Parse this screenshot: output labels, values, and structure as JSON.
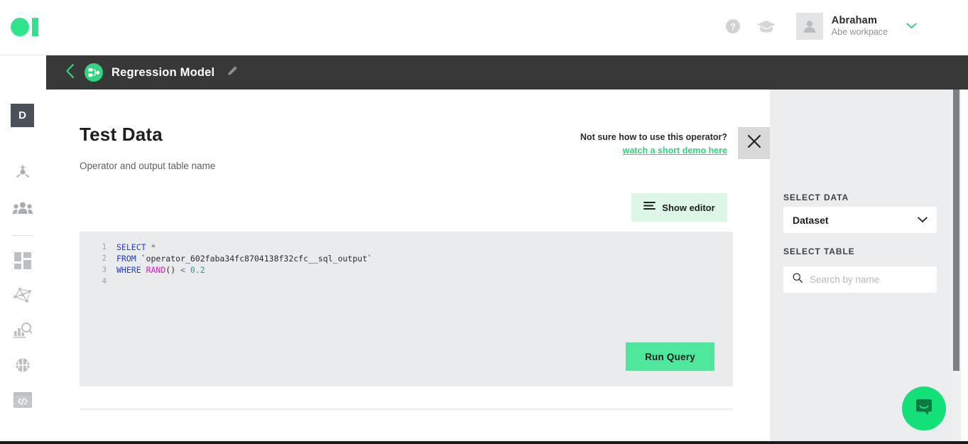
{
  "topbar": {
    "logo_name": "brand-logo",
    "help_icon": "help-circle-icon",
    "learn_icon": "graduation-cap-icon",
    "user": {
      "name": "Abraham",
      "workspace": "Abe workpace",
      "avatar_icon": "user-avatar-icon",
      "caret_icon": "chevron-down-icon"
    }
  },
  "projectbar": {
    "back_icon": "chevron-left-icon",
    "operator_icon": "workflow-node-icon",
    "title": "Regression Model",
    "edit_icon": "pencil-icon"
  },
  "rail": {
    "badge_label": "D",
    "items": [
      {
        "name": "sidebar-item-data-flow",
        "icon": "data-flow-icon"
      },
      {
        "name": "sidebar-item-team",
        "icon": "people-group-icon"
      },
      {
        "name": "sidebar-item-dashboard",
        "icon": "dashboard-grid-icon"
      },
      {
        "name": "sidebar-item-network",
        "icon": "network-graph-icon"
      },
      {
        "name": "sidebar-item-analytics",
        "icon": "chart-search-icon"
      },
      {
        "name": "sidebar-item-ml",
        "icon": "brain-icon"
      },
      {
        "name": "sidebar-item-code",
        "icon": "code-window-icon"
      }
    ]
  },
  "main": {
    "title": "Test Data",
    "subtitle": "Operator and output table name",
    "demo": {
      "question": "Not sure how to use this operator?",
      "link": "watch a short demo here"
    },
    "close_icon": "close-x-icon",
    "show_editor": {
      "label": "Show editor",
      "icon": "editor-lines-icon"
    },
    "editor": {
      "line_numbers": [
        "1",
        "2",
        "3",
        "4"
      ],
      "lines": [
        {
          "n": "1",
          "tokens": [
            {
              "t": "SELECT",
              "c": "kw"
            },
            {
              "t": " ",
              "c": "punct"
            },
            {
              "t": "*",
              "c": "op"
            }
          ]
        },
        {
          "n": "2",
          "tokens": [
            {
              "t": "FROM",
              "c": "kw"
            },
            {
              "t": " `operator_602faba34fc8704138f32cfc__sql_output`",
              "c": "str"
            }
          ]
        },
        {
          "n": "3",
          "tokens": [
            {
              "t": "WHERE",
              "c": "kw"
            },
            {
              "t": " ",
              "c": "punct"
            },
            {
              "t": "RAND",
              "c": "fn"
            },
            {
              "t": "()",
              "c": "punct"
            },
            {
              "t": " < ",
              "c": "op"
            },
            {
              "t": "0.2",
              "c": "num"
            }
          ]
        },
        {
          "n": "4",
          "tokens": []
        }
      ],
      "plain_text": "SELECT *\nFROM `operator_602faba34fc8704138f32cfc__sql_output`\nWHERE RAND() < 0.2\n"
    },
    "run_query_label": "Run Query"
  },
  "rightpanel": {
    "select_data_label": "SELECT DATA",
    "select_data_value": "Dataset",
    "select_data_caret": "chevron-down-icon",
    "select_table_label": "SELECT TABLE",
    "search_icon": "search-icon",
    "search_placeholder": "Search by name",
    "search_value": ""
  },
  "chat": {
    "icon": "intercom-chat-icon"
  },
  "colors": {
    "brand_green": "#2fe48d",
    "button_green": "#4fe79b",
    "link_green": "#2fd67f",
    "header_dark": "#383838",
    "panel_gray": "#ebedee",
    "editor_gray": "#e9ebec",
    "chat_green": "#14e07a"
  }
}
